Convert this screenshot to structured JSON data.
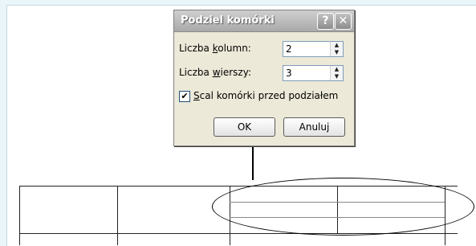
{
  "dialog": {
    "title": "Podziel komórki",
    "help_glyph": "?",
    "close_glyph": "✕",
    "columns_label_pre": "Liczba ",
    "columns_label_accel": "k",
    "columns_label_post": "olumn:",
    "columns_value": "2",
    "rows_label_pre": "Liczba ",
    "rows_label_accel": "w",
    "rows_label_post": "ierszy:",
    "rows_value": "3",
    "merge_checked_glyph": "✔",
    "merge_label_accel": "S",
    "merge_label_post": "cal komórki przed podziałem",
    "ok_label": "OK",
    "cancel_label": "Anuluj",
    "spin_up_glyph": "▲",
    "spin_down_glyph": "▼"
  }
}
